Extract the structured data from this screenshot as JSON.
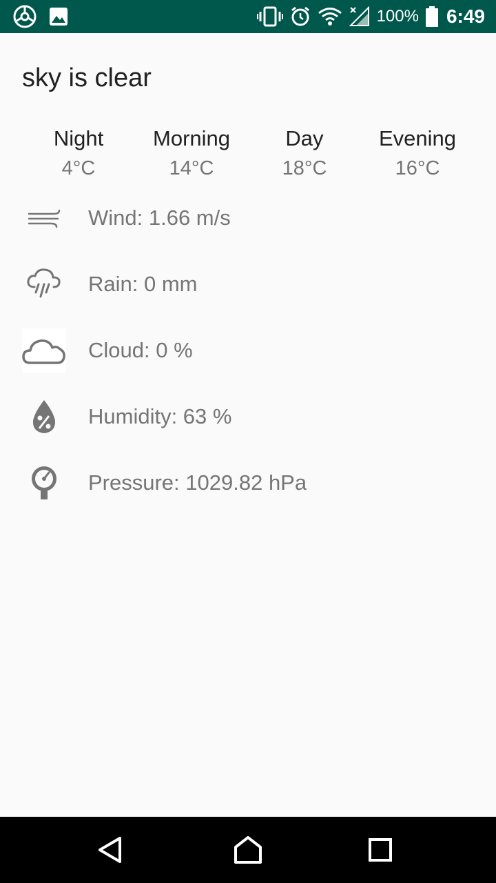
{
  "status_bar": {
    "battery": "100%",
    "time": "6:49",
    "background": "#00574b",
    "icons": [
      "app-icon",
      "image-icon",
      "vibrate-icon",
      "alarm-icon",
      "wifi-icon",
      "signal-icon",
      "battery-icon"
    ]
  },
  "weather": {
    "summary": "sky is clear",
    "periods": [
      {
        "name": "Night",
        "temp": "4°C"
      },
      {
        "name": "Morning",
        "temp": "14°C"
      },
      {
        "name": "Day",
        "temp": "18°C"
      },
      {
        "name": "Evening",
        "temp": "16°C"
      }
    ],
    "details": {
      "wind": "Wind: 1.66 m/s",
      "rain": "Rain: 0 mm",
      "cloud": "Cloud: 0 %",
      "humidity": "Humidity: 63 %",
      "pressure": "Pressure: 1029.82 hPa"
    }
  },
  "nav_bar": {
    "icons": [
      "back-icon",
      "home-icon",
      "recents-icon"
    ]
  }
}
